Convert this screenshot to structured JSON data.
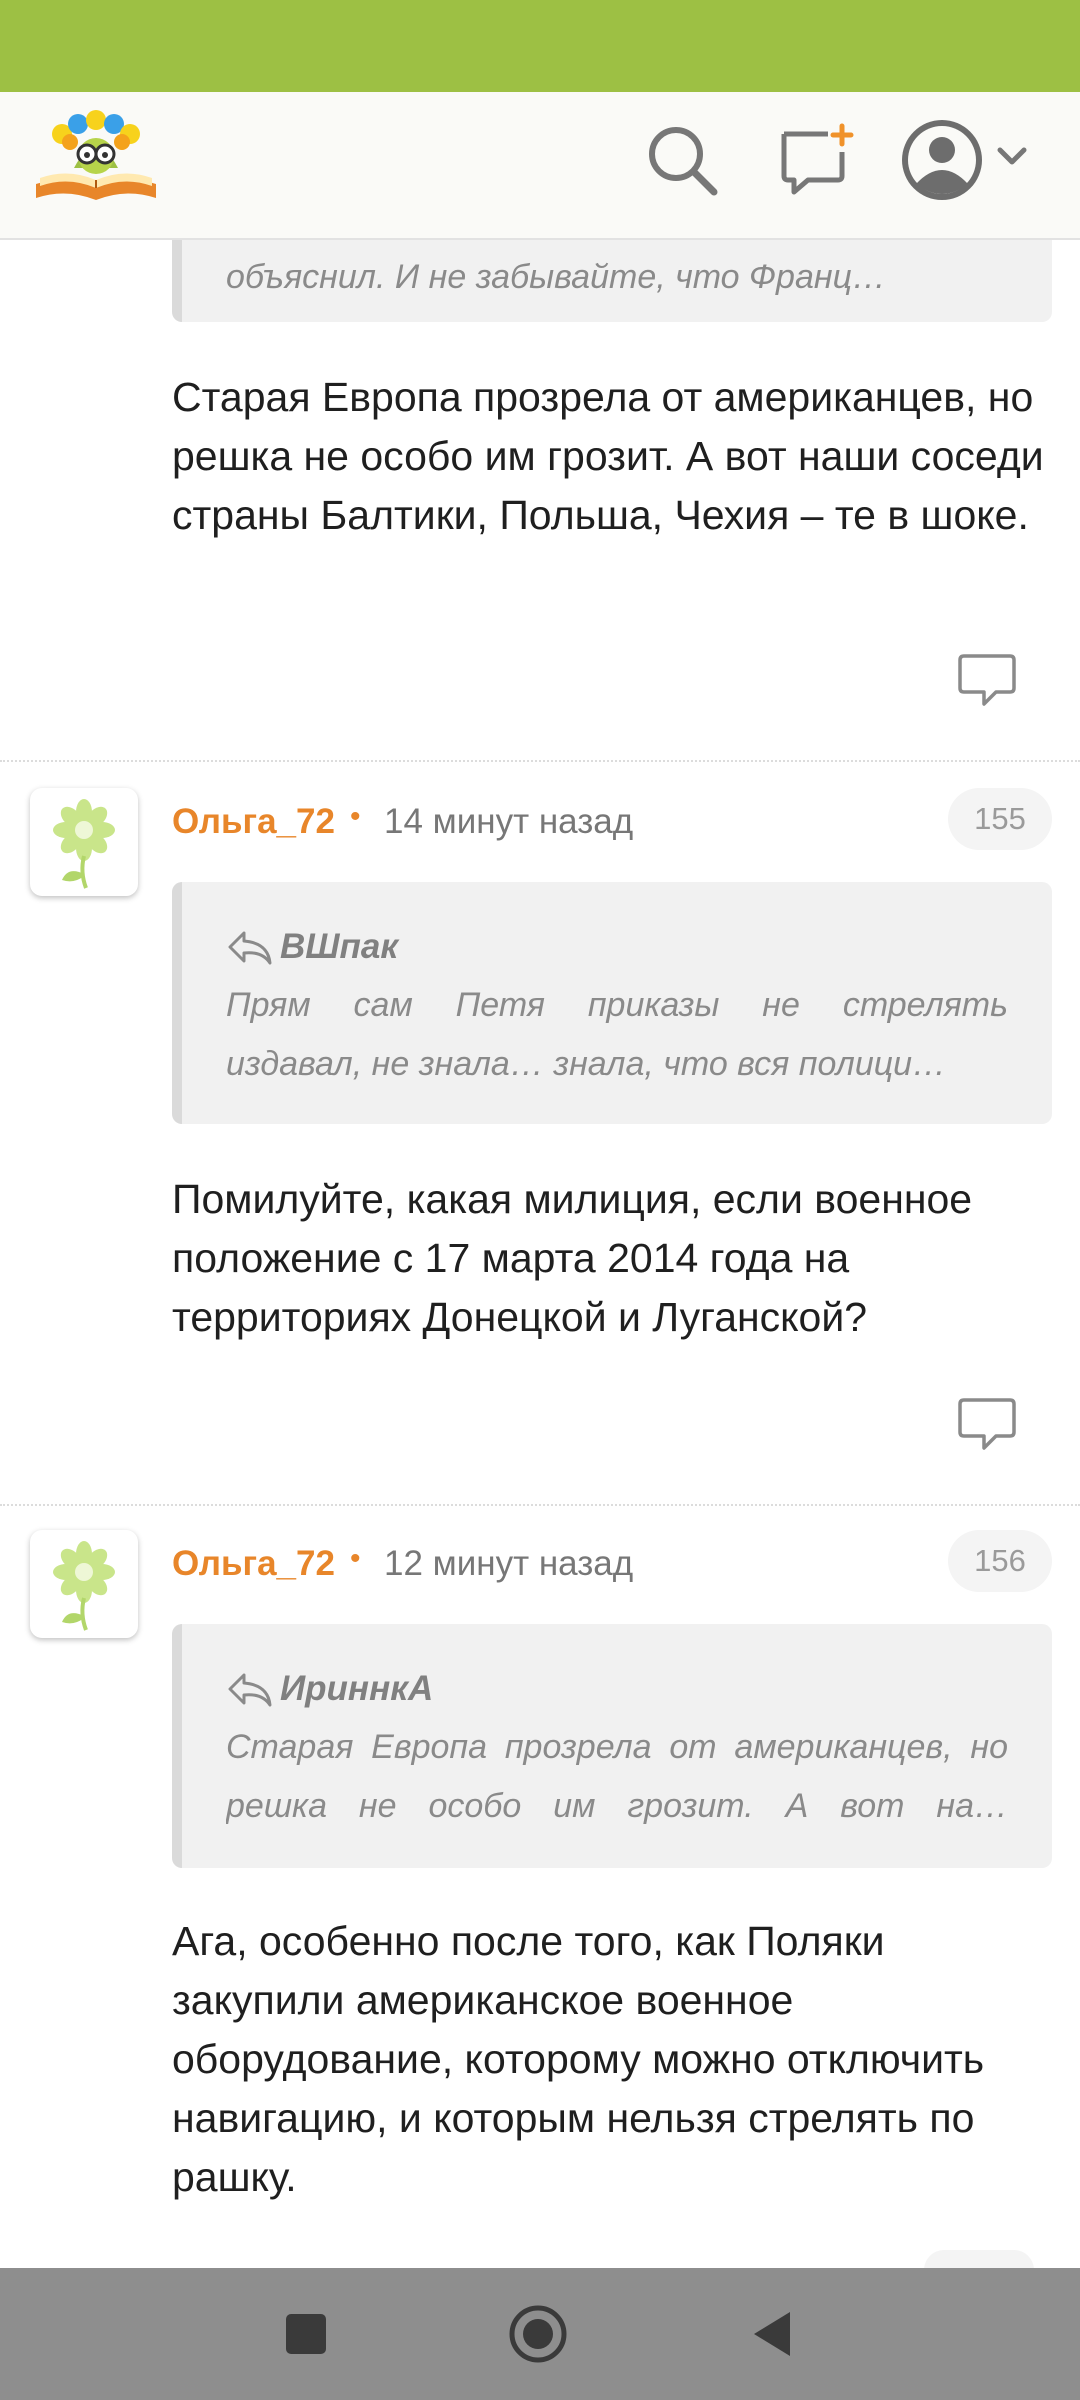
{
  "header": {
    "logo_name": "site-logo",
    "icons": [
      "search-icon",
      "compose-icon",
      "avatar-icon",
      "chevron-down-icon"
    ]
  },
  "colors": {
    "status_bar": "#9dc044",
    "accent_author": "#e8862a",
    "nav_bar": "#8e8e8e"
  },
  "first_comment": {
    "quote_tail": "объяснил. И не забывайте, что Франц…",
    "body": "Старая Европа прозрела от американцев, но решка не особо им грозит. А вот наши соседи страны Балтики, Польша, Чехия – те в шоке."
  },
  "comments": [
    {
      "author": "Ольга_72",
      "time": "14 минут назад",
      "number": "155",
      "quote_author": "ВШпак",
      "quote_line1": "Прям сам Петя приказы не стрелять",
      "quote_line2": "издавал, не знала… знала, что вся полици…",
      "body": "Помилуйте, какая милиция, если военное положение с 17 марта 2014 года на территориях Донецкой и Луганской?"
    },
    {
      "author": "Ольга_72",
      "time": "12 минут назад",
      "number": "156",
      "quote_author": "ИриннкА",
      "quote_line1": "Старая Европа прозрела от американцев, но",
      "quote_line2": "решка не особо им грозит. А вот на…",
      "body": "Ага, особенно после того, как Поляки закупили американское военное оборудование, которому можно отключить навигацию, и которым нельзя стрелять по рашку."
    }
  ],
  "nav": {
    "buttons": [
      "recents-button",
      "home-button",
      "back-button"
    ]
  }
}
